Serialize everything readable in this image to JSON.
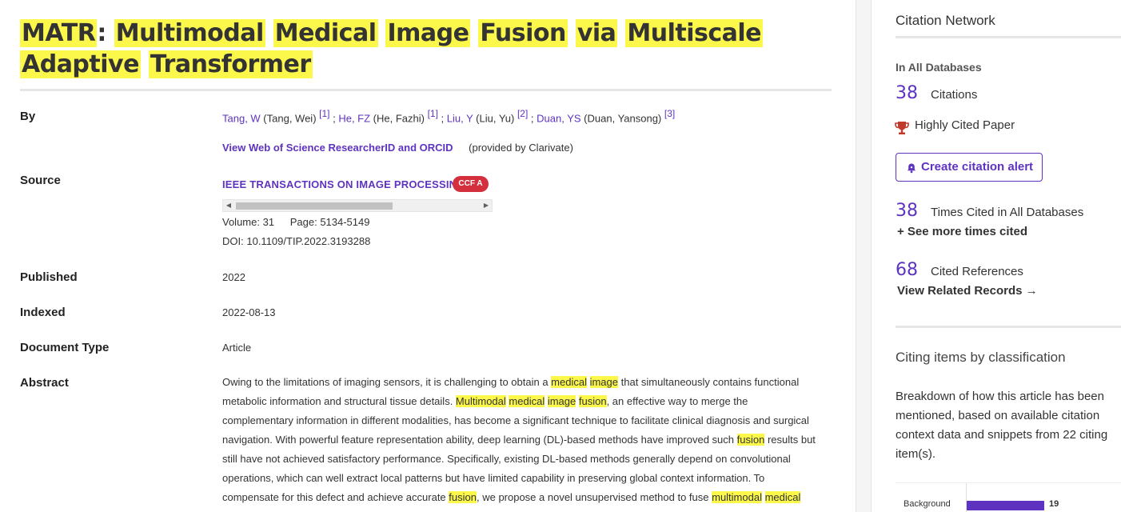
{
  "title_words": [
    "MATR",
    ":",
    "Multimodal",
    "Medical",
    "Image",
    "Fusion",
    "via",
    "Multiscale",
    "Adaptive",
    "Transformer"
  ],
  "labels": {
    "by": "By",
    "source": "Source",
    "published": "Published",
    "indexed": "Indexed",
    "document_type": "Document Type",
    "abstract": "Abstract"
  },
  "authors": [
    {
      "short": "Tang, W",
      "full": "(Tang, Wei)",
      "ref": "[1]"
    },
    {
      "short": "He, FZ",
      "full": "(He, Fazhi)",
      "ref": "[1]"
    },
    {
      "short": "Liu, Y",
      "full": "(Liu, Yu)",
      "ref": "[2]"
    },
    {
      "short": "Duan, YS",
      "full": "(Duan, Yansong)",
      "ref": "[3]"
    }
  ],
  "researcher_link": "View Web of Science ResearcherID and ORCID",
  "provided_by": "(provided by Clarivate)",
  "source": {
    "journal": "IEEE TRANSACTIONS ON IMAGE PROCESSING",
    "badge": "CCF A",
    "volume_label": "Volume:",
    "volume": "31",
    "page_label": "Page:",
    "pages": "5134-5149",
    "doi_label": "DOI:",
    "doi": "10.1109/TIP.2022.3193288"
  },
  "published": "2022",
  "indexed": "2022-08-13",
  "document_type": "Article",
  "abstract_lines": [
    [
      [
        "Owing to the limitations of imaging sensors, it is challenging to obtain a ",
        false
      ],
      [
        "medical",
        true
      ],
      [
        " ",
        false
      ],
      [
        "image",
        true
      ],
      [
        " that simultaneously contains functional",
        false
      ]
    ],
    [
      [
        "metabolic information and structural tissue details. ",
        false
      ],
      [
        "Multimodal",
        true
      ],
      [
        " ",
        false
      ],
      [
        "medical",
        true
      ],
      [
        " ",
        false
      ],
      [
        "image",
        true
      ],
      [
        " ",
        false
      ],
      [
        "fusion",
        true
      ],
      [
        ", an effective way to merge the",
        false
      ]
    ],
    [
      [
        "complementary information in different modalities, has become a significant technique to facilitate clinical diagnosis and surgical",
        false
      ]
    ],
    [
      [
        "navigation. With powerful feature representation ability, deep learning (DL)-based methods have improved such ",
        false
      ],
      [
        "fusion",
        true
      ],
      [
        " results but",
        false
      ]
    ],
    [
      [
        "still have not achieved satisfactory performance. Specifically, existing DL-based methods generally depend on convolutional",
        false
      ]
    ],
    [
      [
        "operations, which can well extract local patterns but have limited capability in preserving global context information. To",
        false
      ]
    ],
    [
      [
        "compensate for this defect and achieve accurate ",
        false
      ],
      [
        "fusion",
        true
      ],
      [
        ", we propose a novel unsupervised method to fuse ",
        false
      ],
      [
        "multimodal",
        true
      ],
      [
        " ",
        false
      ],
      [
        "medical",
        true
      ]
    ]
  ],
  "sidebar": {
    "network_title": "Citation Network",
    "in_all_db": "In All Databases",
    "citations_count": "38",
    "citations_label": "Citations",
    "highly_cited": "Highly Cited Paper",
    "create_alert": "Create citation alert",
    "times_cited_count": "38",
    "times_cited_label": "Times Cited in All Databases",
    "see_more": "+ See more times cited",
    "cited_refs_count": "68",
    "cited_refs_label": "Cited References",
    "view_related": "View Related Records →",
    "classification_title": "Citing items by classification",
    "classification_desc": "Breakdown of how this article has been mentioned, based on available citation context data and snippets from 22 citing item(s).",
    "chart_label": "Background",
    "chart_value": "19"
  },
  "colors": {
    "accent": "#5e33bf",
    "highlight": "#fbf74b",
    "badge": "#d32f3d",
    "trophy": "#c0392b"
  }
}
